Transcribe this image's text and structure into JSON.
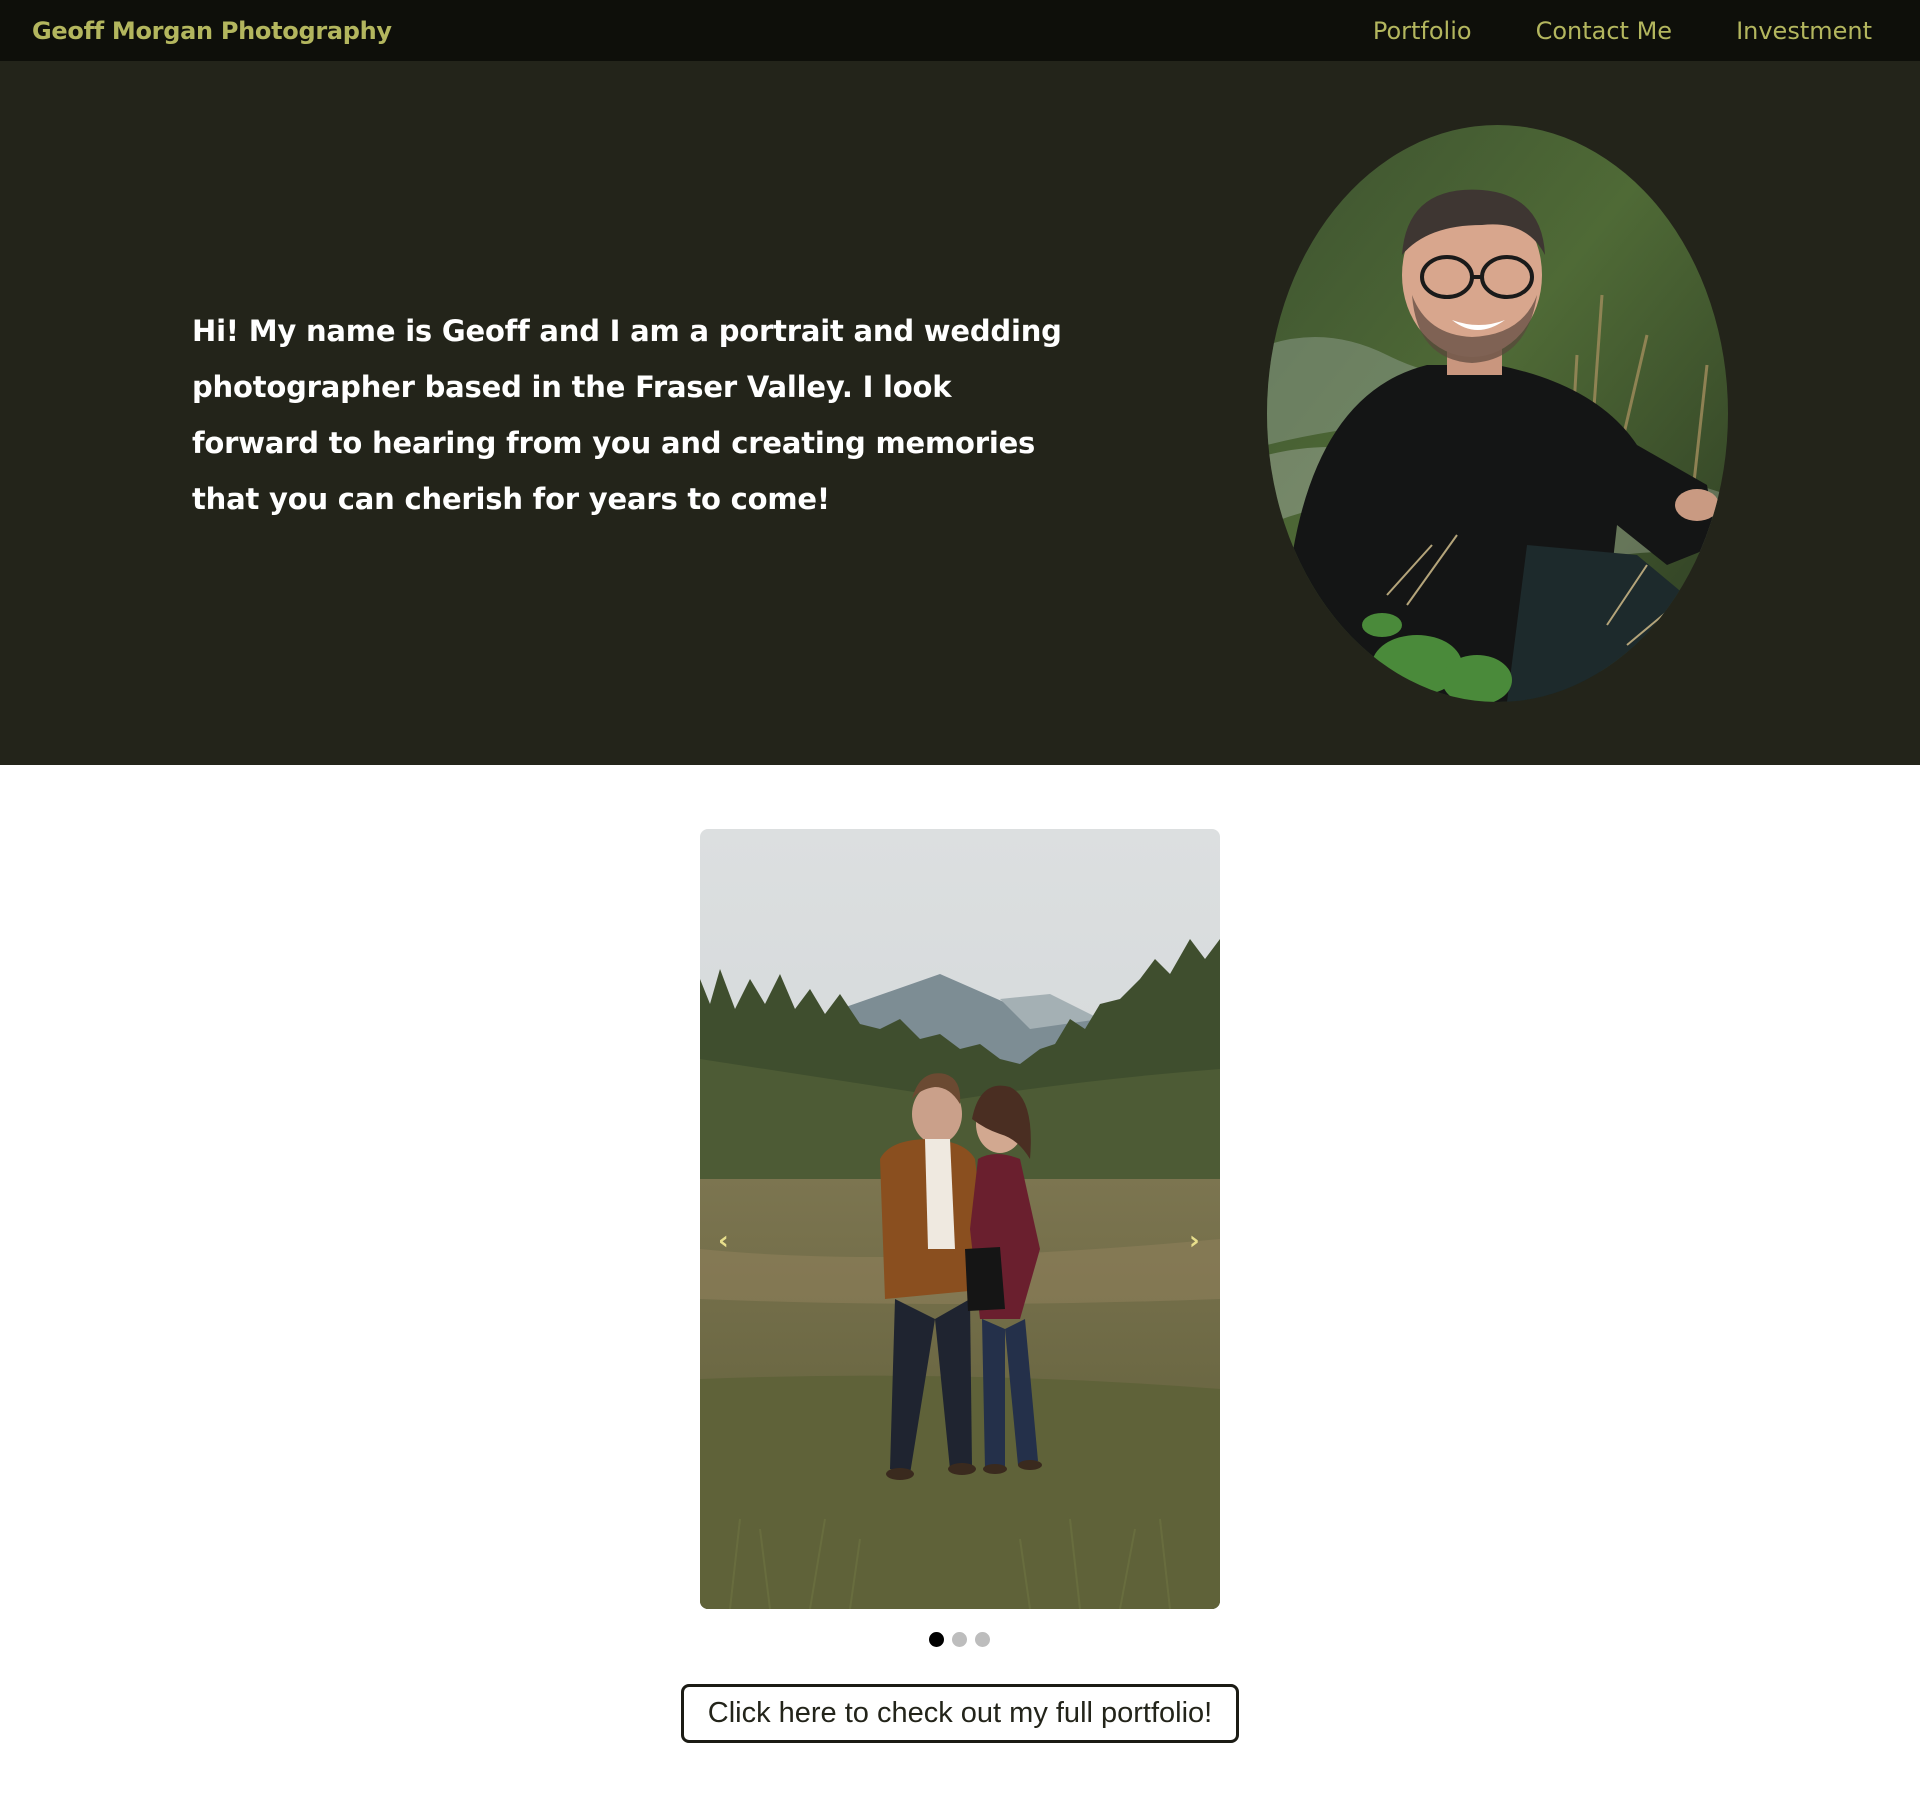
{
  "nav": {
    "brand": "Geoff Morgan Photography",
    "links": [
      {
        "label": "Portfolio"
      },
      {
        "label": "Contact Me"
      },
      {
        "label": "Investment"
      }
    ]
  },
  "hero": {
    "intro": "Hi! My name is Geoff and I am a portrait and wedding photographer based in the Fraser Valley. I look forward to hearing from you and creating memories that you can cherish for years to come!"
  },
  "carousel": {
    "prev_label": "‹",
    "next_label": "›",
    "slide_count": 3,
    "active_slide": 1
  },
  "cta": {
    "label": "Click here to check out my full portfolio!"
  },
  "colors": {
    "nav_bg": "#0e0f0a",
    "hero_bg": "#23241a",
    "accent": "#b3b65e"
  }
}
